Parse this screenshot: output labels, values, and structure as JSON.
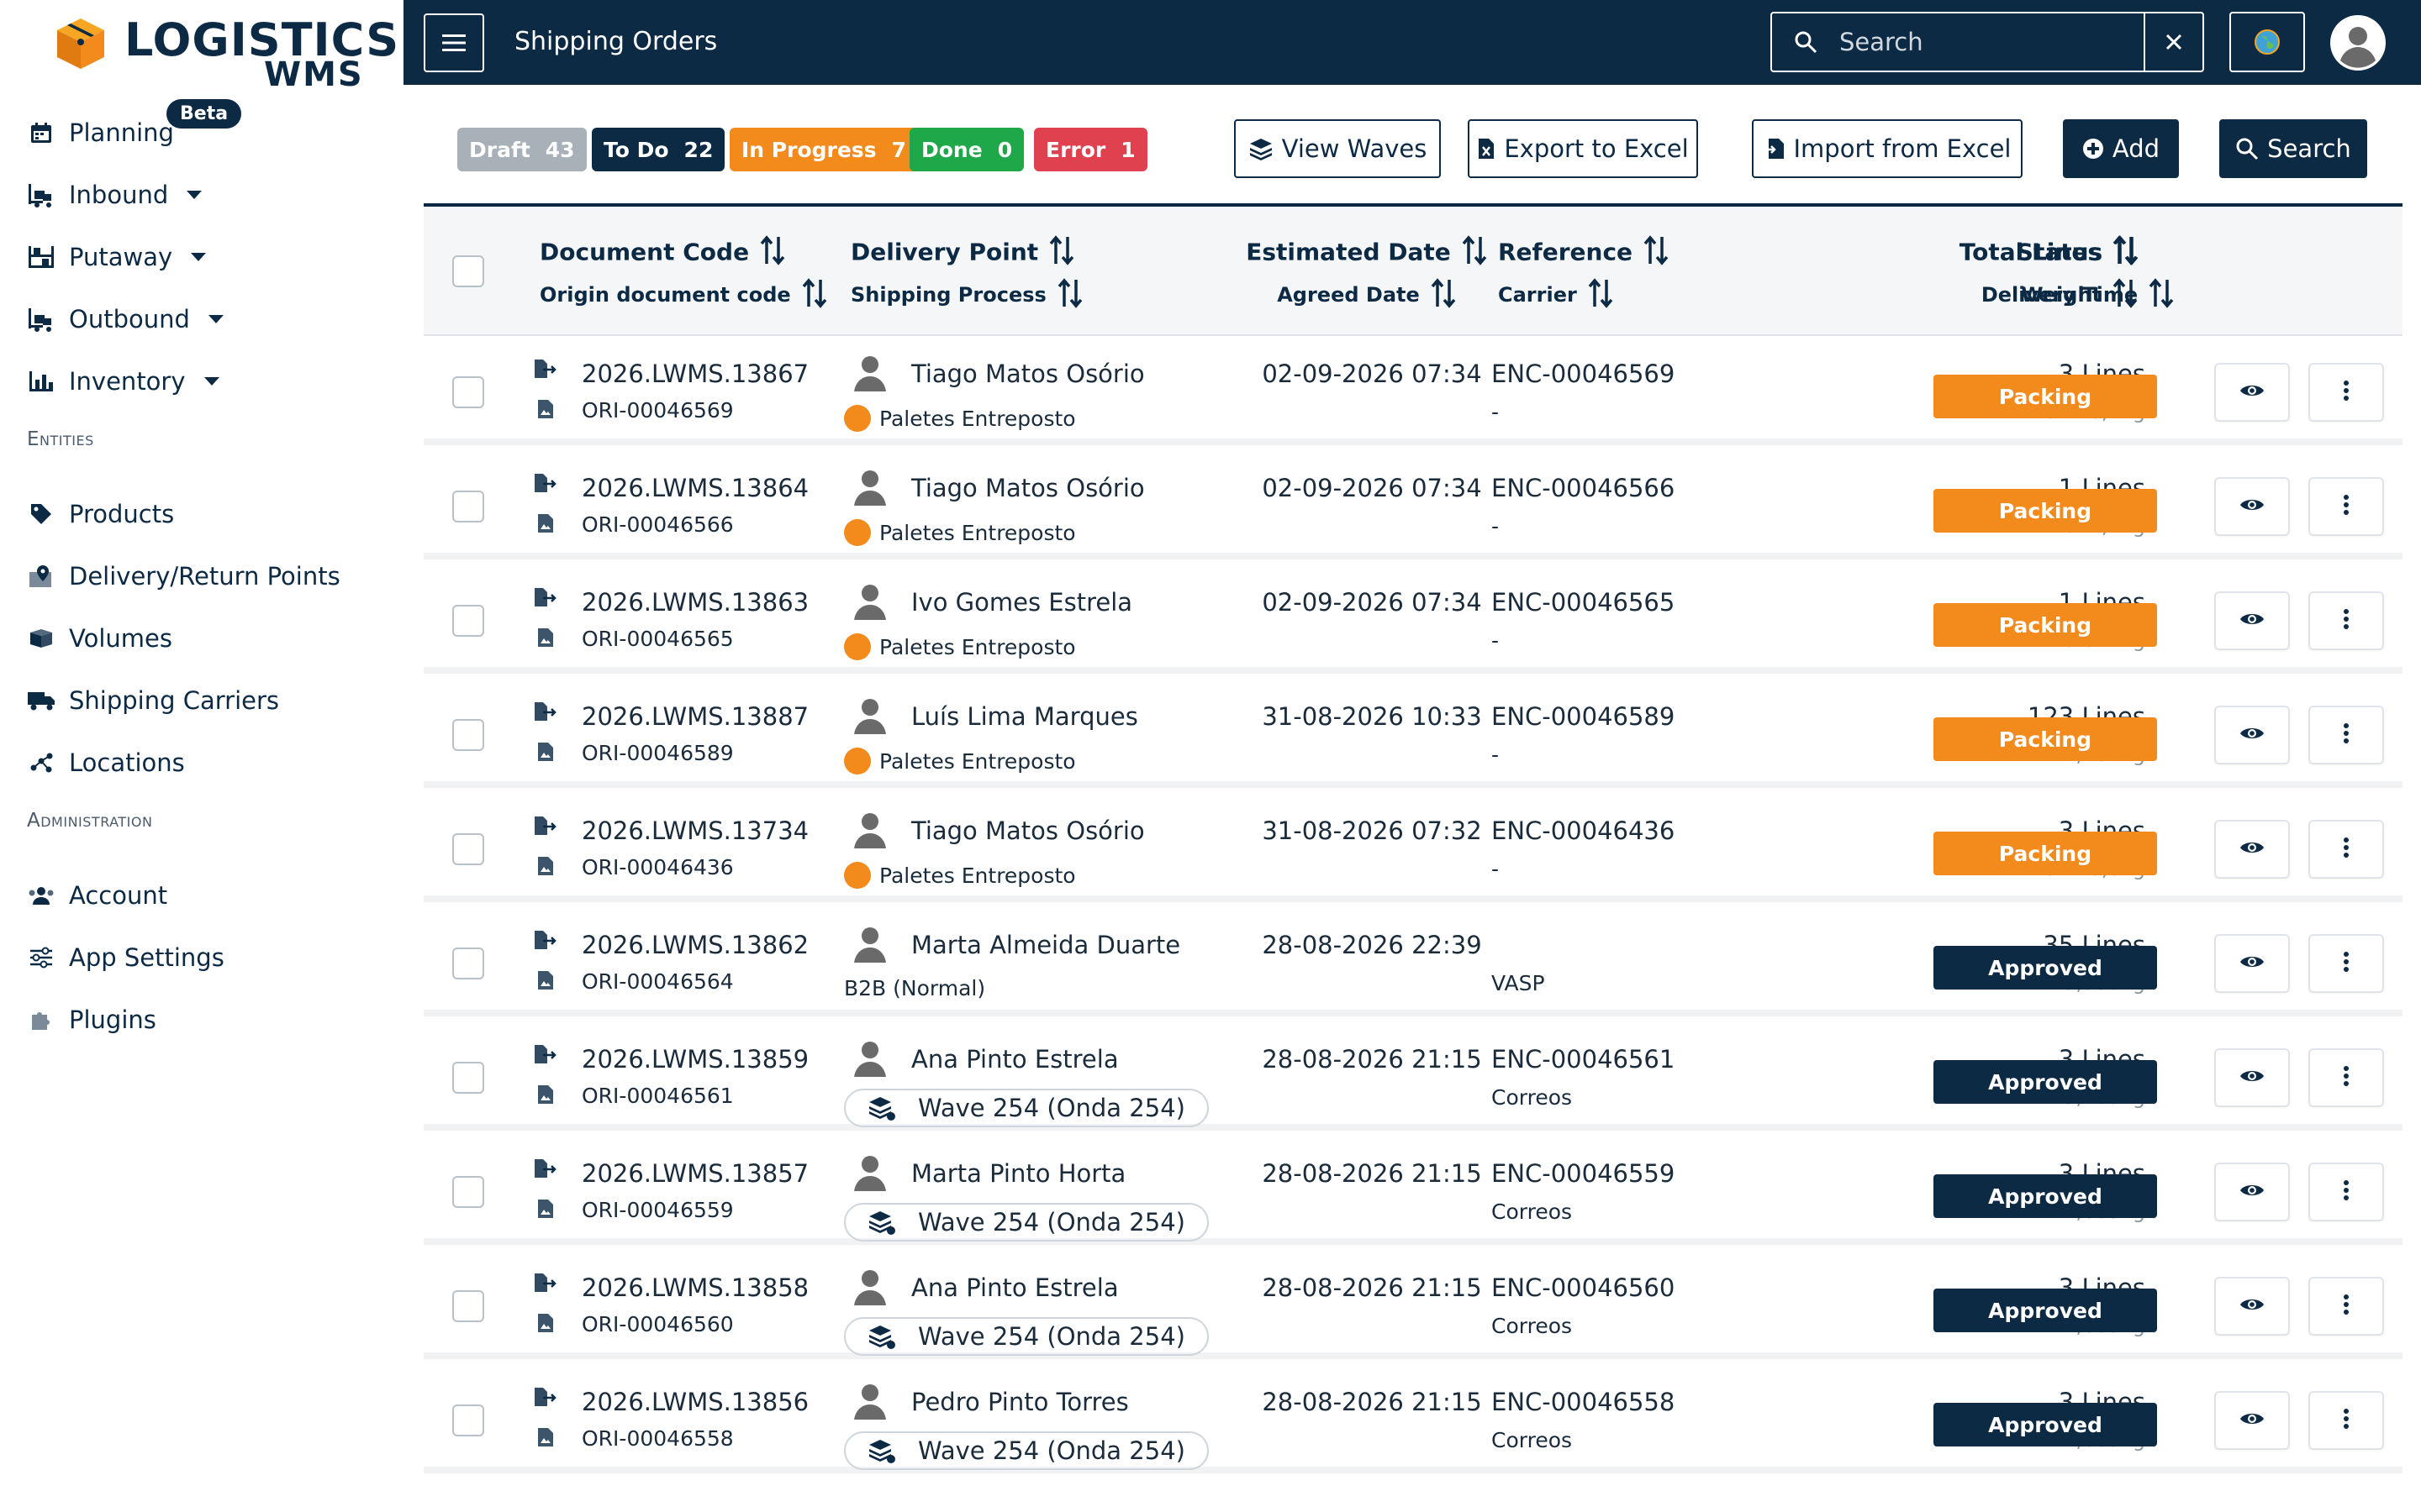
{
  "app": {
    "logo_text": "LOGISTICS",
    "logo_sub": "WMS",
    "page_title": "Shipping Orders"
  },
  "sidebar": {
    "items": [
      {
        "label": "Planning",
        "icon": "calendar-icon",
        "caret": false
      },
      {
        "label": "Inbound",
        "icon": "forklift-icon",
        "caret": true
      },
      {
        "label": "Putaway",
        "icon": "shelves-icon",
        "caret": true
      },
      {
        "label": "Outbound",
        "icon": "forklift-icon",
        "caret": true
      },
      {
        "label": "Inventory",
        "icon": "barchart-icon",
        "caret": true
      }
    ],
    "beta": "Beta",
    "entities_title": "Entities",
    "entities": [
      {
        "label": "Products",
        "icon": "tag-icon"
      },
      {
        "label": "Delivery/Return Points",
        "icon": "map-pin-icon"
      },
      {
        "label": "Volumes",
        "icon": "box-icon"
      },
      {
        "label": "Shipping Carriers",
        "icon": "truck-icon"
      },
      {
        "label": "Locations",
        "icon": "network-icon"
      }
    ],
    "admin_title": "Administration",
    "admin": [
      {
        "label": "Account",
        "icon": "users-icon"
      },
      {
        "label": "App Settings",
        "icon": "sliders-icon"
      },
      {
        "label": "Plugins",
        "icon": "puzzle-icon"
      }
    ]
  },
  "topbar": {
    "search_placeholder": "Search"
  },
  "filters": [
    {
      "label": "Draft",
      "count": "43",
      "color": "#a8b0b8"
    },
    {
      "label": "To Do",
      "count": "22",
      "color": "#0d2a45"
    },
    {
      "label": "In Progress",
      "count": "7",
      "color": "#f28a1c"
    },
    {
      "label": "Done",
      "count": "0",
      "color": "#1ea84a"
    },
    {
      "label": "Error",
      "count": "1",
      "color": "#e0414f"
    }
  ],
  "toolbar": {
    "view_waves": "View Waves",
    "export": "Export to Excel",
    "import": "Import from Excel",
    "add": "Add",
    "search": "Search"
  },
  "columns": {
    "doc_a": "Document Code",
    "doc_b": "Origin document code",
    "dp_a": "Delivery Point",
    "dp_b": "Shipping Process",
    "date_a": "Estimated Date",
    "date_b": "Agreed Date",
    "ref_a": "Reference",
    "ref_b": "Carrier",
    "lines_a": "Total Lines",
    "lines_b": "Weight",
    "status_a": "Status",
    "status_b": "Delivery Time"
  },
  "rows": [
    {
      "doc": "2026.LWMS.13867",
      "ori": "ORI-00046569",
      "name": "Tiago Matos Osório",
      "process": "Paletes Entreposto",
      "ptype": "dot",
      "date": "02-09-2026 07:34",
      "ref": "ENC-00046569",
      "carrier": "-",
      "lines": "3 Lines",
      "weight": "18 246,4kg",
      "status": "Packing",
      "skind": "packing"
    },
    {
      "doc": "2026.LWMS.13864",
      "ori": "ORI-00046566",
      "name": "Tiago Matos Osório",
      "process": "Paletes Entreposto",
      "ptype": "dot",
      "date": "02-09-2026 07:34",
      "ref": "ENC-00046566",
      "carrier": "-",
      "lines": "1 Lines",
      "weight": "2 822,4kg",
      "status": "Packing",
      "skind": "packing"
    },
    {
      "doc": "2026.LWMS.13863",
      "ori": "ORI-00046565",
      "name": "Ivo Gomes Estrela",
      "process": "Paletes Entreposto",
      "ptype": "dot",
      "date": "02-09-2026 07:34",
      "ref": "ENC-00046565",
      "carrier": "-",
      "lines": "1 Lines",
      "weight": "3 672kg",
      "status": "Packing",
      "skind": "packing"
    },
    {
      "doc": "2026.LWMS.13887",
      "ori": "ORI-00046589",
      "name": "Luís Lima Marques",
      "process": "Paletes Entreposto",
      "ptype": "dot",
      "date": "31-08-2026 10:33",
      "ref": "ENC-00046589",
      "carrier": "-",
      "lines": "123 Lines",
      "weight": "742,407kg",
      "status": "Packing",
      "skind": "packing"
    },
    {
      "doc": "2026.LWMS.13734",
      "ori": "ORI-00046436",
      "name": "Tiago Matos Osório",
      "process": "Paletes Entreposto",
      "ptype": "dot",
      "date": "31-08-2026 07:32",
      "ref": "ENC-00046436",
      "carrier": "-",
      "lines": "3 Lines",
      "weight": "13 140,8kg",
      "status": "Packing",
      "skind": "packing"
    },
    {
      "doc": "2026.LWMS.13862",
      "ori": "ORI-00046564",
      "name": "Marta Almeida Duarte",
      "process": "B2B (Normal)",
      "ptype": "text",
      "date": "28-08-2026 22:39",
      "ref": "",
      "carrier": "VASP",
      "lines": "35 Lines",
      "weight": "125,539kg",
      "status": "Approved",
      "skind": "approved"
    },
    {
      "doc": "2026.LWMS.13859",
      "ori": "ORI-00046561",
      "name": "Ana Pinto Estrela",
      "process": "Wave 254 (Onda 254)",
      "ptype": "wave",
      "date": "28-08-2026 21:15",
      "ref": "ENC-00046561",
      "carrier": "Correos",
      "lines": "3 Lines",
      "weight": "5,185kg",
      "status": "Approved",
      "skind": "approved"
    },
    {
      "doc": "2026.LWMS.13857",
      "ori": "ORI-00046559",
      "name": "Marta Pinto Horta",
      "process": "Wave 254 (Onda 254)",
      "ptype": "wave",
      "date": "28-08-2026 21:15",
      "ref": "ENC-00046559",
      "carrier": "Correos",
      "lines": "3 Lines",
      "weight": "7,685kg",
      "status": "Approved",
      "skind": "approved"
    },
    {
      "doc": "2026.LWMS.13858",
      "ori": "ORI-00046560",
      "name": "Ana Pinto Estrela",
      "process": "Wave 254 (Onda 254)",
      "ptype": "wave",
      "date": "28-08-2026 21:15",
      "ref": "ENC-00046560",
      "carrier": "Correos",
      "lines": "3 Lines",
      "weight": "7,685kg",
      "status": "Approved",
      "skind": "approved"
    },
    {
      "doc": "2026.LWMS.13856",
      "ori": "ORI-00046558",
      "name": "Pedro Pinto Torres",
      "process": "Wave 254 (Onda 254)",
      "ptype": "wave",
      "date": "28-08-2026 21:15",
      "ref": "ENC-00046558",
      "carrier": "Correos",
      "lines": "3 Lines",
      "weight": "7,685kg",
      "status": "Approved",
      "skind": "approved"
    }
  ]
}
